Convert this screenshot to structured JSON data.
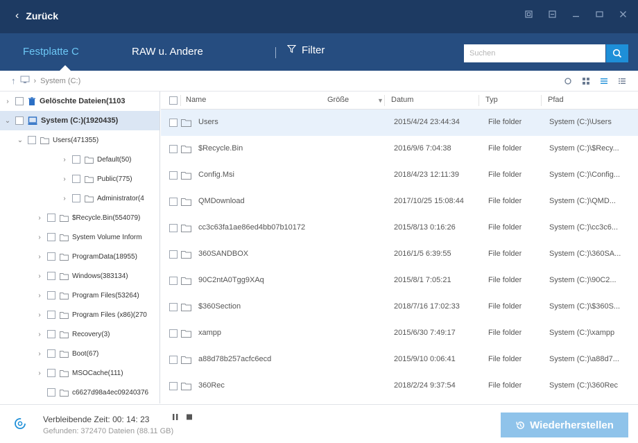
{
  "header": {
    "back_label": "Zurück",
    "window_controls": [
      "restore-icon",
      "maximize-icon",
      "minimize-icon",
      "fullscreen-icon",
      "close-icon"
    ]
  },
  "nav": {
    "tabs": [
      {
        "label": "Festplatte C",
        "active": true
      },
      {
        "label": "RAW u. Andere",
        "active": false
      }
    ],
    "filter_label": "Filter",
    "search_placeholder": "Suchen"
  },
  "path": {
    "crumb": "System (C:)"
  },
  "tree": [
    {
      "label": "Gelöschte Dateien(1103",
      "level": 0,
      "arrow": "›",
      "icon": "trash",
      "top": true,
      "selected": false
    },
    {
      "label": "System (C:)(1920435)",
      "level": 0,
      "arrow": "⌄",
      "icon": "drive",
      "top": true,
      "selected": true
    },
    {
      "label": "Users(471355)",
      "level": 1,
      "arrow": "⌄",
      "icon": "folder"
    },
    {
      "label": "Default(50)",
      "level": 2,
      "arrow": "›",
      "icon": "folder"
    },
    {
      "label": "Public(775)",
      "level": 2,
      "arrow": "›",
      "icon": "folder"
    },
    {
      "label": "Administrator(4",
      "level": 2,
      "arrow": "›",
      "icon": "folder"
    },
    {
      "label": "$Recycle.Bin(554079)",
      "level": 1,
      "arrow": "›",
      "icon": "folder"
    },
    {
      "label": "System Volume Inform",
      "level": 1,
      "arrow": "›",
      "icon": "folder"
    },
    {
      "label": "ProgramData(18955)",
      "level": 1,
      "arrow": "›",
      "icon": "folder"
    },
    {
      "label": "Windows(383134)",
      "level": 1,
      "arrow": "›",
      "icon": "folder"
    },
    {
      "label": "Program Files(53264)",
      "level": 1,
      "arrow": "›",
      "icon": "folder"
    },
    {
      "label": "Program Files (x86)(270",
      "level": 1,
      "arrow": "›",
      "icon": "folder"
    },
    {
      "label": "Recovery(3)",
      "level": 1,
      "arrow": "›",
      "icon": "folder"
    },
    {
      "label": "Boot(67)",
      "level": 1,
      "arrow": "›",
      "icon": "folder"
    },
    {
      "label": "MSOCache(111)",
      "level": 1,
      "arrow": "›",
      "icon": "folder"
    },
    {
      "label": "c6627d98a4ec09240376",
      "level": 1,
      "arrow": "",
      "icon": "folder"
    }
  ],
  "list": {
    "columns": {
      "name": "Name",
      "size": "Größe",
      "date": "Datum",
      "type": "Typ",
      "path": "Pfad"
    },
    "rows": [
      {
        "name": "Users",
        "size": "",
        "date": "2015/4/24 23:44:34",
        "type": "File folder",
        "path": "System (C:)\\Users",
        "selected": true
      },
      {
        "name": "$Recycle.Bin",
        "size": "",
        "date": "2016/9/6 7:04:38",
        "type": "File folder",
        "path": "System (C:)\\$Recy..."
      },
      {
        "name": "Config.Msi",
        "size": "",
        "date": "2018/4/23 12:11:39",
        "type": "File folder",
        "path": "System (C:)\\Config..."
      },
      {
        "name": "QMDownload",
        "size": "",
        "date": "2017/10/25 15:08:44",
        "type": "File folder",
        "path": "System (C:)\\QMD..."
      },
      {
        "name": "cc3c63fa1ae86ed4bb07b10172",
        "size": "",
        "date": "2015/8/13 0:16:26",
        "type": "File folder",
        "path": "System (C:)\\cc3c6..."
      },
      {
        "name": "360SANDBOX",
        "size": "",
        "date": "2016/1/5 6:39:55",
        "type": "File folder",
        "path": "System (C:)\\360SA..."
      },
      {
        "name": "90C2ntA0Tgg9XAq",
        "size": "",
        "date": "2015/8/1 7:05:21",
        "type": "File folder",
        "path": "System (C:)\\90C2..."
      },
      {
        "name": "$360Section",
        "size": "",
        "date": "2018/7/16 17:02:33",
        "type": "File folder",
        "path": "System (C:)\\$360S..."
      },
      {
        "name": "xampp",
        "size": "",
        "date": "2015/6/30 7:49:17",
        "type": "File folder",
        "path": "System (C:)\\xampp"
      },
      {
        "name": "a88d78b257acfc6ecd",
        "size": "",
        "date": "2015/9/10 0:06:41",
        "type": "File folder",
        "path": "System (C:)\\a88d7..."
      },
      {
        "name": "360Rec",
        "size": "",
        "date": "2018/2/24 9:37:54",
        "type": "File folder",
        "path": "System (C:)\\360Rec"
      }
    ]
  },
  "footer": {
    "remaining": "Verbleibende Zeit: 00: 14: 23",
    "found": "Gefunden: 372470 Dateien (88.11 GB)",
    "pause_icon": "pause-icon",
    "stop_icon": "stop-icon",
    "recover_label": "Wiederherstellen"
  },
  "colors": {
    "title_bar": "#1d3a62",
    "nav_bar": "#264d80",
    "active_tab": "#6cc7f5",
    "accent": "#1e8fd8",
    "recover_button": "#8fc3ea",
    "tree_selected": "#dbe6f4",
    "row_selected": "#e8f1fb"
  }
}
